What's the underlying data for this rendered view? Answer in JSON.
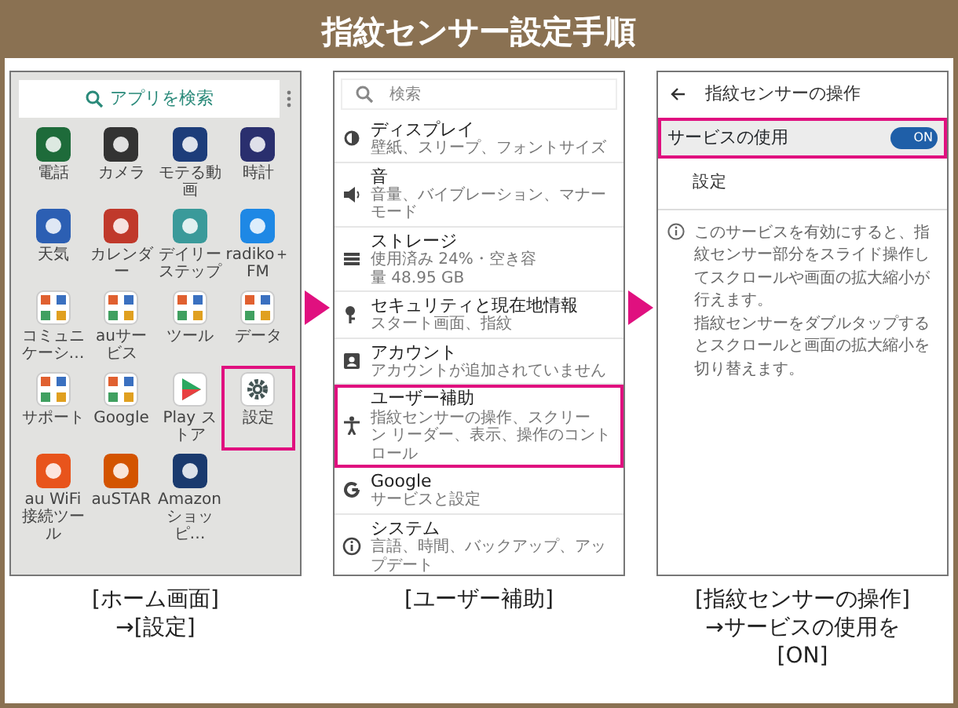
{
  "title": "指紋センサー設定手順",
  "steps": [
    {
      "kind": "home",
      "search": "アプリを検索",
      "apps": [
        {
          "label": "電話",
          "kind": "app",
          "color": "#1e6b3a",
          "selected": false
        },
        {
          "label": "カメラ",
          "kind": "app",
          "color": "#333333",
          "selected": false
        },
        {
          "label": "モテる動画",
          "kind": "app",
          "color": "#1d3d7a",
          "selected": false
        },
        {
          "label": "時計",
          "kind": "app",
          "color": "#2a2f6e",
          "selected": false
        },
        {
          "label": "天気",
          "kind": "app",
          "color": "#2c5fb3",
          "selected": false
        },
        {
          "label": "カレンダー",
          "kind": "app",
          "color": "#c0392b",
          "selected": false
        },
        {
          "label": "デイリーステップ",
          "kind": "app",
          "color": "#3a9a9a",
          "selected": false
        },
        {
          "label": "radiko＋FM",
          "kind": "app",
          "color": "#1e88e5",
          "selected": false
        },
        {
          "label": "コミュニケーシ…",
          "kind": "folder",
          "color": "#ffffff",
          "selected": false
        },
        {
          "label": "auサービス",
          "kind": "folder",
          "color": "#ffffff",
          "selected": false
        },
        {
          "label": "ツール",
          "kind": "folder",
          "color": "#ffffff",
          "selected": false
        },
        {
          "label": "データ",
          "kind": "folder",
          "color": "#ffffff",
          "selected": false
        },
        {
          "label": "サポート",
          "kind": "folder",
          "color": "#ffffff",
          "selected": false
        },
        {
          "label": "Google",
          "kind": "folder",
          "color": "#ffffff",
          "selected": false
        },
        {
          "label": "Play ストア",
          "kind": "play",
          "color": "#ffffff",
          "selected": false
        },
        {
          "label": "設定",
          "kind": "gear",
          "color": "#ffffff",
          "selected": true
        },
        {
          "label": "au WiFi接続ツール",
          "kind": "app",
          "color": "#e8541c",
          "selected": false
        },
        {
          "label": "auSTAR",
          "kind": "app",
          "color": "#d35400",
          "selected": false
        },
        {
          "label": "Amazon ショッピ…",
          "kind": "app",
          "color": "#1a3a6e",
          "selected": false
        }
      ],
      "caption": [
        "[ホーム画面]",
        "→[設定]"
      ]
    },
    {
      "kind": "settings",
      "search": "検索",
      "items": [
        {
          "title": "ディスプレイ",
          "subtitle": "壁紙、スリープ、フォントサイズ",
          "selected": false
        },
        {
          "title": "音",
          "subtitle": "音量、バイブレーション、マナーモード",
          "selected": false
        },
        {
          "title": "ストレージ",
          "subtitle": "使用済み 24%・空き容量 48.95 GB",
          "selected": false
        },
        {
          "title": "セキュリティと現在地情報",
          "subtitle": "スタート画面、指紋",
          "selected": false
        },
        {
          "title": "アカウント",
          "subtitle": "アカウントが追加されていません",
          "selected": false
        },
        {
          "title": "ユーザー補助",
          "subtitle": "指紋センサーの操作、スクリーン リーダー、表示、操作のコントロール",
          "selected": true
        },
        {
          "title": "Google",
          "subtitle": "サービスと設定",
          "selected": false
        },
        {
          "title": "システム",
          "subtitle": "言語、時間、バックアップ、アップデート",
          "selected": false
        }
      ],
      "caption": [
        "[ユーザー補助]"
      ]
    },
    {
      "kind": "detail",
      "header": "指紋センサーの操作",
      "switch": {
        "label": "サービスの使用",
        "on": true,
        "text": "ON",
        "selected": true
      },
      "subheading": "設定",
      "info": [
        "このサービスを有効にすると、指紋センサー部分をスライド操作してスクロールや画面の拡大縮小が行えます。",
        "指紋センサーをダブルタップするとスクロールと画面の拡大縮小を切り替えます。"
      ],
      "caption": [
        "[指紋センサーの操作]",
        "→サービスの使用を",
        "[ON]"
      ]
    }
  ]
}
